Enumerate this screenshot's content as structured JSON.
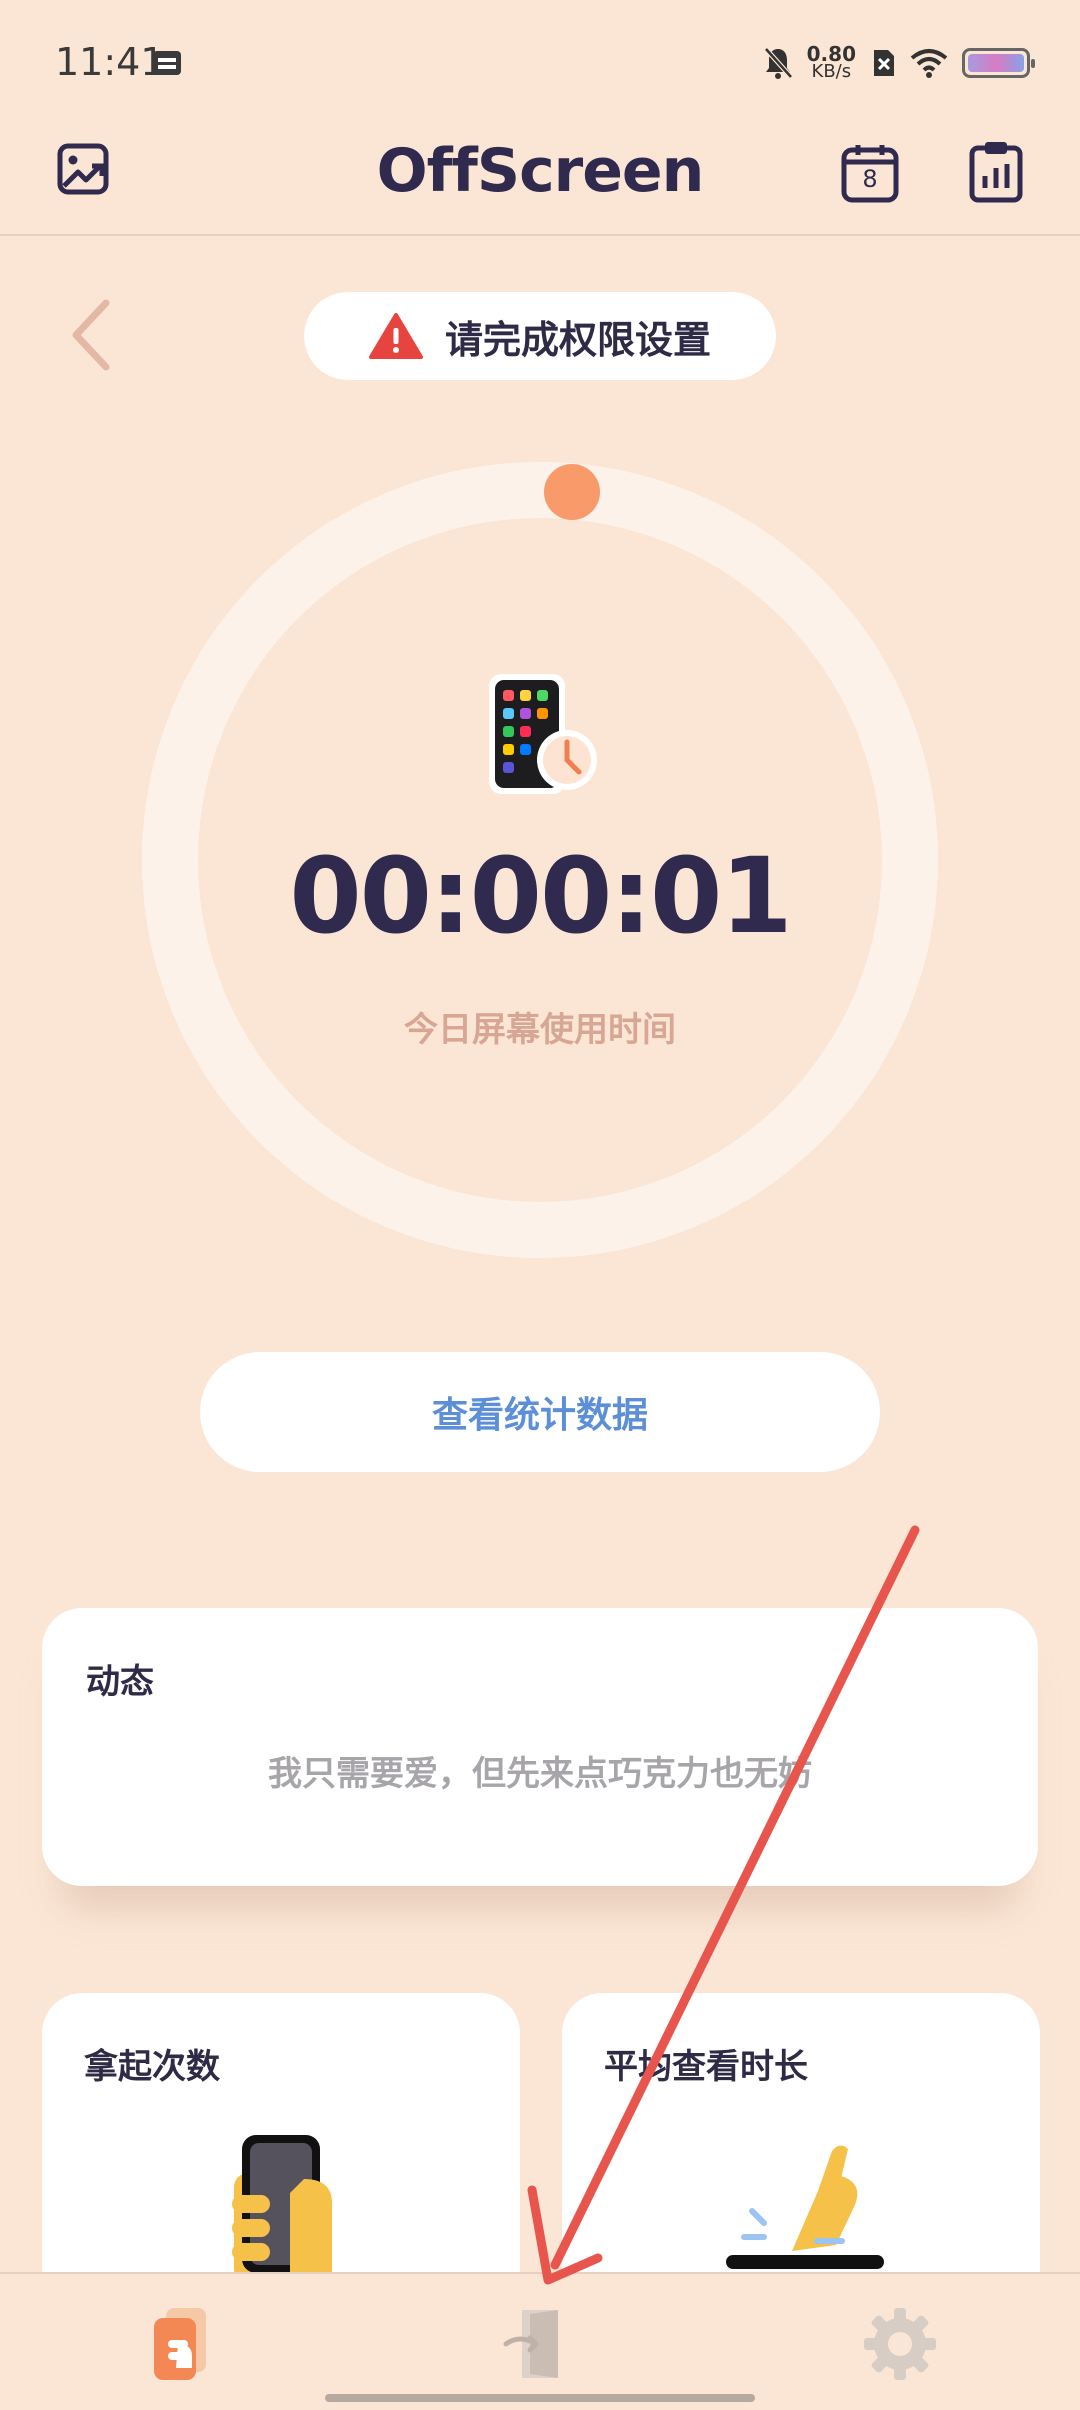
{
  "status_bar": {
    "time": "11:41",
    "speed_value": "0.80",
    "speed_unit": "KB/s",
    "icons": [
      "calendar-icon",
      "bell-muted-icon",
      "sim-x-icon",
      "wifi-icon",
      "battery-icon"
    ]
  },
  "header": {
    "title": "OffScreen",
    "calendar_day": "8",
    "icons": [
      "chart-image-icon",
      "calendar-icon",
      "clipboard-stats-icon"
    ]
  },
  "permission_banner": {
    "text": "请完成权限设置",
    "icon": "warning-icon"
  },
  "timer": {
    "value": "00:00:01",
    "label": "今日屏幕使用时间",
    "icon": "phone-clock-icon"
  },
  "stats_button": {
    "label": "查看统计数据"
  },
  "dynamic_card": {
    "title": "动态",
    "quote": "我只需要爱，但先来点巧克力也无妨"
  },
  "pickup_card": {
    "title": "拿起次数",
    "icon": "hand-phone-icon"
  },
  "avg_card": {
    "title": "平均查看时长",
    "icon": "tap-icon"
  },
  "bottom_nav": {
    "items": [
      "home-tab",
      "exit-tab",
      "settings-tab"
    ],
    "active": "home-tab"
  },
  "colors": {
    "background": "#fbe6d5",
    "accent_orange": "#f89a6a",
    "title_navy": "#2f2a4e",
    "link_blue": "#5c8fd6",
    "annotation_red": "#e8554d"
  }
}
